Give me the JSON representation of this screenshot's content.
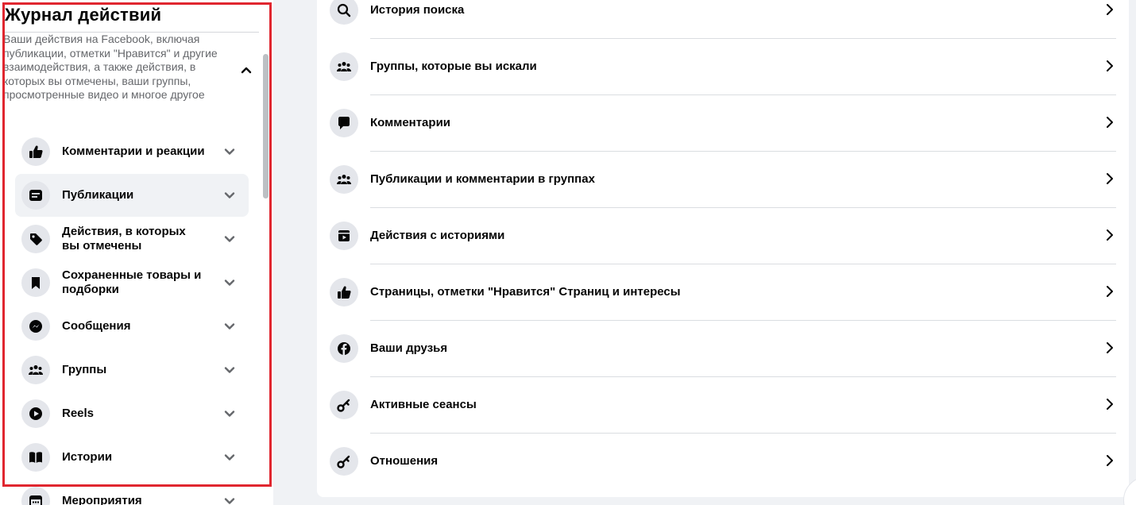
{
  "sidebar": {
    "title": "Журнал действий",
    "description": "Ваши действия на Facebook, включая публикации, отметки \"Нравится\" и другие взаимодействия, а также действия, в которых вы отмечены, ваши группы, просмотренные видео и многое другое",
    "items": [
      {
        "label": "Комментарии и реакции",
        "icon": "thumbs-up-icon"
      },
      {
        "label": "Публикации",
        "icon": "post-icon"
      },
      {
        "label": "Действия, в которых вы отмечены",
        "icon": "tag-icon"
      },
      {
        "label": "Сохраненные товары и подборки",
        "icon": "bookmark-icon"
      },
      {
        "label": "Сообщения",
        "icon": "messenger-icon"
      },
      {
        "label": "Группы",
        "icon": "groups-icon"
      },
      {
        "label": "Reels",
        "icon": "play-icon"
      },
      {
        "label": "Истории",
        "icon": "book-icon"
      },
      {
        "label": "Мероприятия",
        "icon": "calendar-icon"
      }
    ]
  },
  "main": {
    "rows": [
      {
        "label": "История поиска",
        "icon": "search-icon"
      },
      {
        "label": "Группы, которые вы искали",
        "icon": "groups-icon"
      },
      {
        "label": "Комментарии",
        "icon": "comment-icon"
      },
      {
        "label": "Публикации и комментарии в группах",
        "icon": "groups-icon"
      },
      {
        "label": "Действия с историями",
        "icon": "stories-icon"
      },
      {
        "label": "Страницы, отметки \"Нравится\" Страниц и интересы",
        "icon": "thumbs-up-icon"
      },
      {
        "label": "Ваши друзья",
        "icon": "facebook-icon"
      },
      {
        "label": "Активные сеансы",
        "icon": "key-icon"
      },
      {
        "label": "Отношения",
        "icon": "key-icon"
      }
    ]
  },
  "colors": {
    "highlight": "#e0262f",
    "icon_bg": "#e4e6eb",
    "selected_bg": "#f0f2f5",
    "secondary_text": "#65676b"
  }
}
